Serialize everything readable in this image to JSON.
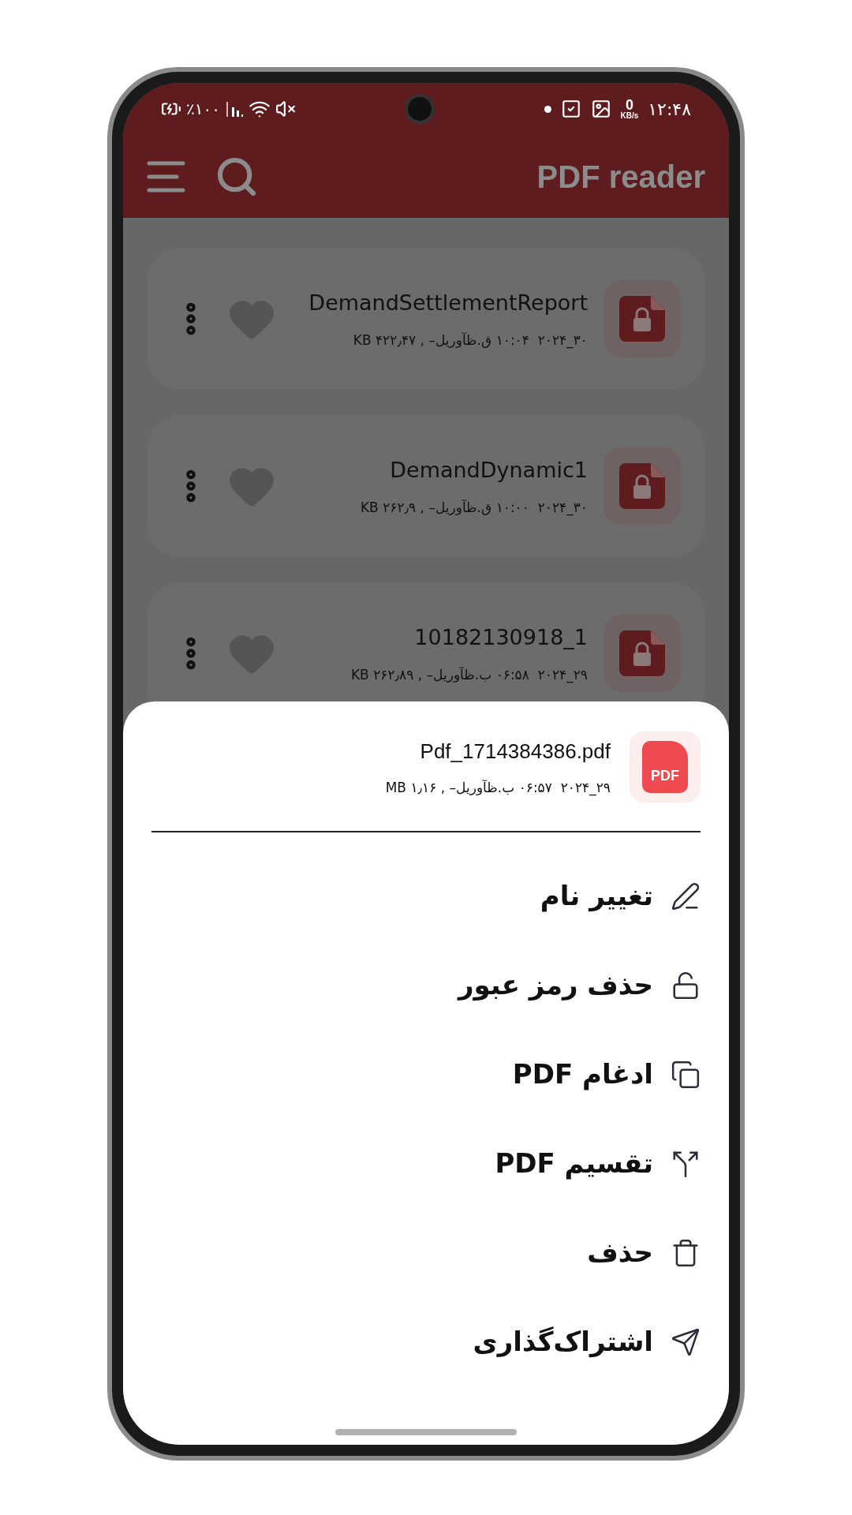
{
  "status_bar": {
    "battery_text": "٪۱۰۰",
    "speed_value": "0",
    "speed_unit": "KB/s",
    "time": "۱۲:۴۸"
  },
  "app_bar": {
    "title": "PDF reader"
  },
  "files": [
    {
      "name": "DemandSettlementReport",
      "meta": "۳۰_۲۰۲۴  ۱۰:۰۴ ق.ظآوریل– , ۴۲۲٫۴۷ KB",
      "favorite": false
    },
    {
      "name": "DemandDynamic1",
      "meta": "۳۰_۲۰۲۴  ۱۰:۰۰ ق.ظآوریل– , ۲۶۲٫۹ KB",
      "favorite": false
    },
    {
      "name": "10182130918_1",
      "meta": "۲۹_۲۰۲۴  ۰۶:۵۸ ب.ظآوریل– , ۲۶۲٫۸۹ KB",
      "favorite": false
    }
  ],
  "sheet": {
    "file_name": "Pdf_1714384386.pdf",
    "meta": "۲۹_۲۰۲۴  ۰۶:۵۷ ب.ظآوریل– , ۱٫۱۶ MB",
    "icon_label": "PDF",
    "actions": [
      {
        "label": "تغییر نام",
        "kind": "rename"
      },
      {
        "label": "حذف رمز عبور",
        "kind": "unlock"
      },
      {
        "label": "ادغام PDF",
        "kind": "merge"
      },
      {
        "label": "تقسیم PDF",
        "kind": "split"
      },
      {
        "label": "حذف",
        "kind": "delete"
      },
      {
        "label": "اشتراک‌گذاری",
        "kind": "share"
      }
    ]
  }
}
